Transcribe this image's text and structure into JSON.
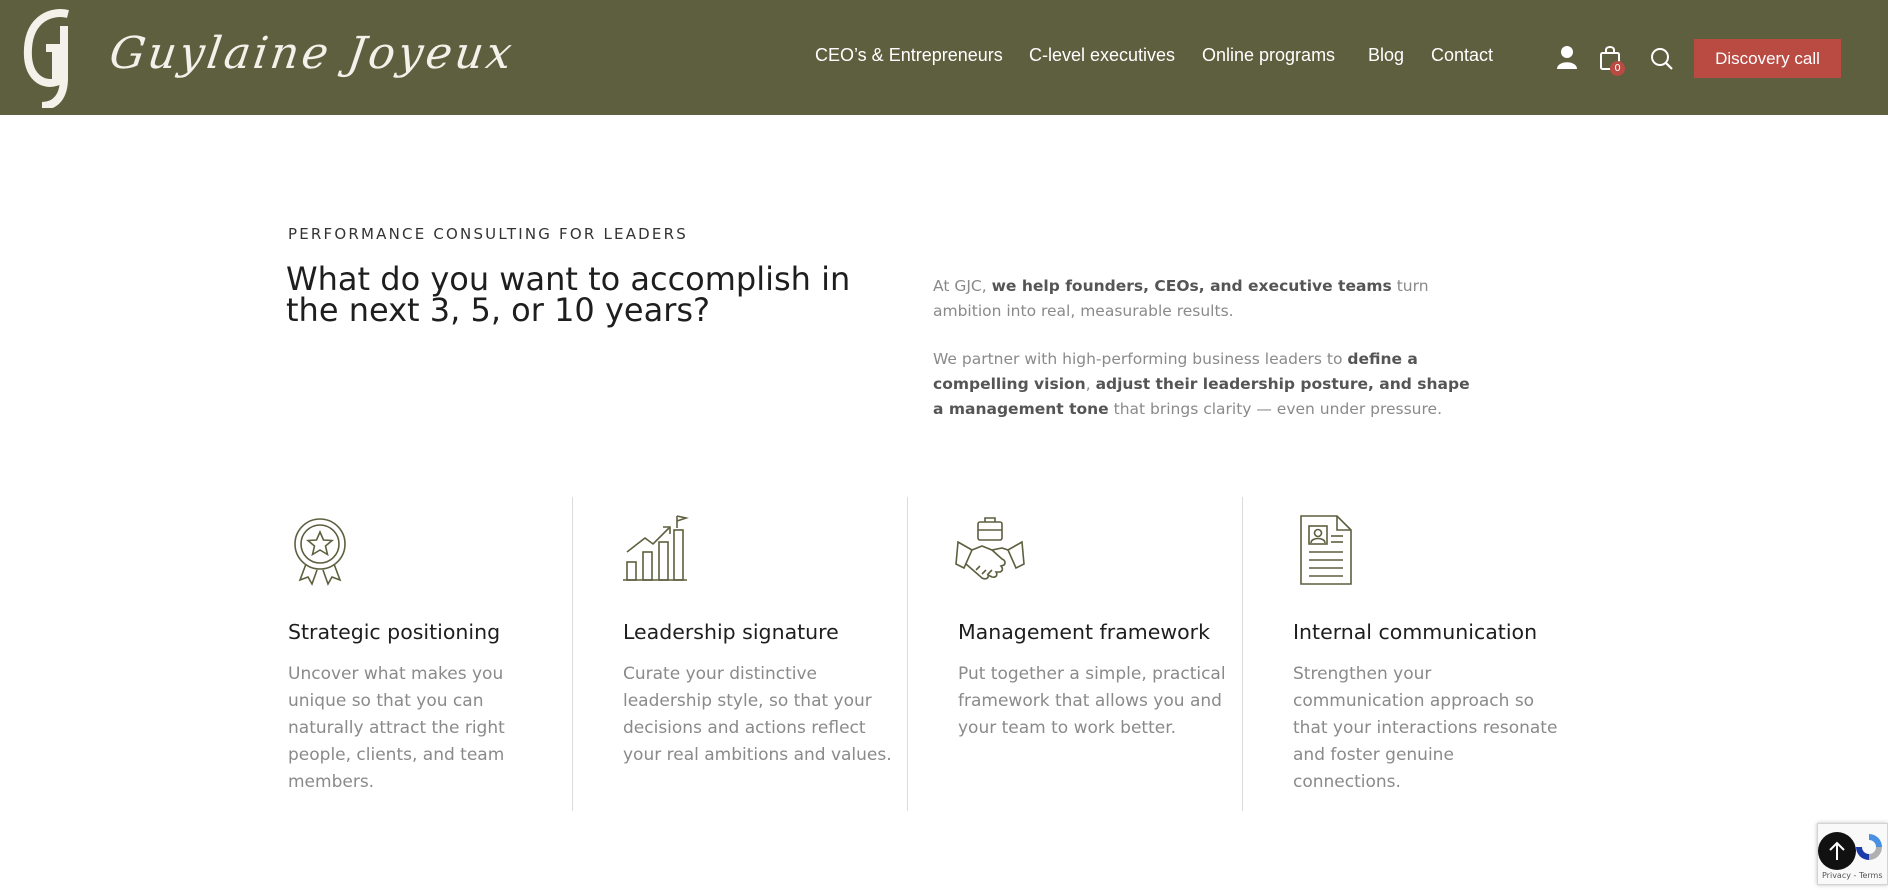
{
  "brand": {
    "logo_letters": "GJ",
    "name": "Guylaine Joyeux"
  },
  "nav": {
    "items": [
      {
        "label": "CEO’s & Entrepreneurs"
      },
      {
        "label": "C-level executives"
      },
      {
        "label": "Online programs"
      },
      {
        "label": "Blog"
      },
      {
        "label": "Contact"
      }
    ],
    "icons": [
      "user-icon",
      "shopping-bag-icon",
      "search-icon"
    ],
    "cart_count": "0",
    "cta_label": "Discovery call"
  },
  "colors": {
    "header_bg": "#5e5f3f",
    "accent": "#b94b43",
    "icon_stroke": "#5e5f3f"
  },
  "intro": {
    "eyebrow": "PERFORMANCE CONSULTING FOR LEADERS",
    "headline": "What do you want to accomplish in the next 3, 5, or 10 years?",
    "p1": {
      "pre": "At GJC, ",
      "bold": "we help founders, CEOs, and executive teams",
      "post": " turn ambition into real, measurable results."
    },
    "p2": {
      "pre": "We partner with high-performing business leaders to ",
      "bold1": "define a compelling vision",
      "mid": ", ",
      "bold2": "adjust their leadership posture, and shape a management tone",
      "post": " that brings clarity — even under pressure."
    }
  },
  "features": [
    {
      "icon": "award-ribbon-icon",
      "title": "Strategic positioning",
      "desc": "Uncover what makes you unique so that you can naturally attract the right people, clients, and team members."
    },
    {
      "icon": "growth-chart-icon",
      "title": "Leadership signature",
      "desc": "Curate your distinctive leadership style, so that your decisions and actions reflect your real ambitions and values."
    },
    {
      "icon": "handshake-icon",
      "title": "Management framework",
      "desc": "Put together a simple, practical framework that allows you and your team to work better."
    },
    {
      "icon": "document-profile-icon",
      "title": "Internal communication",
      "desc": "Strengthen your communication approach so that your interactions resonate and foster genuine connections."
    }
  ],
  "recaptcha": {
    "text": "Privacy - Terms"
  }
}
